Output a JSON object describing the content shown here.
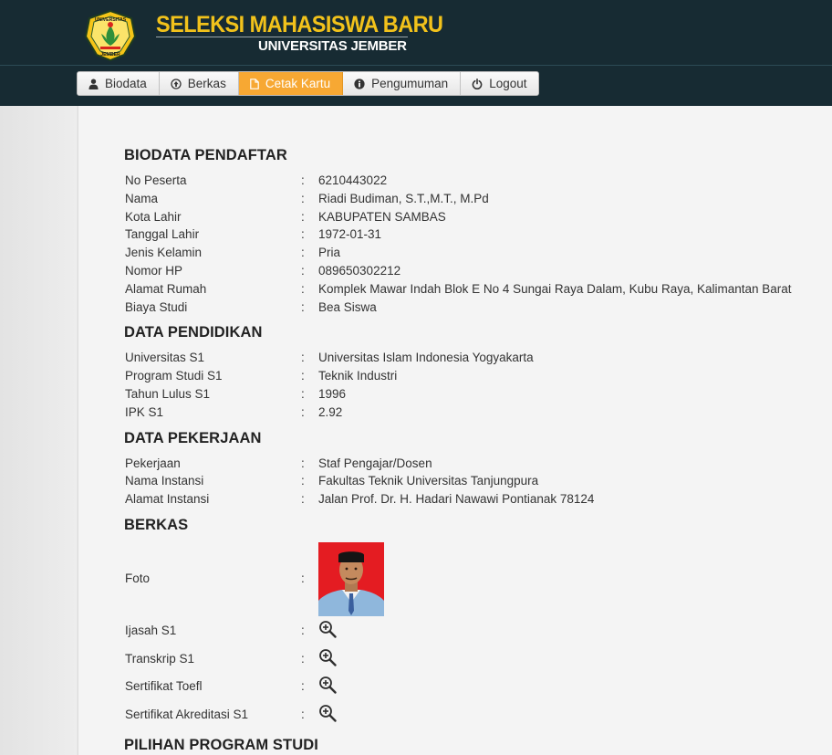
{
  "header": {
    "title": "SELEKSI MAHASISWA BARU",
    "subtitle": "UNIVERSITAS JEMBER",
    "logo_text_top": "UNIVERSITAS",
    "logo_text_bottom": "JEMBER"
  },
  "nav": {
    "items": [
      {
        "label": "Biodata",
        "icon": "user-icon"
      },
      {
        "label": "Berkas",
        "icon": "upload-icon"
      },
      {
        "label": "Cetak Kartu",
        "icon": "file-icon",
        "active": true
      },
      {
        "label": "Pengumuman",
        "icon": "info-icon"
      },
      {
        "label": "Logout",
        "icon": "power-icon"
      }
    ]
  },
  "biodata": {
    "title": "BIODATA PENDAFTAR",
    "rows": [
      {
        "label": "No Peserta",
        "value": "6210443022"
      },
      {
        "label": "Nama",
        "value": "Riadi Budiman, S.T.,M.T., M.Pd"
      },
      {
        "label": "Kota Lahir",
        "value": "KABUPATEN SAMBAS"
      },
      {
        "label": "Tanggal Lahir",
        "value": "1972-01-31"
      },
      {
        "label": "Jenis Kelamin",
        "value": "Pria"
      },
      {
        "label": "Nomor HP",
        "value": "089650302212"
      },
      {
        "label": "Alamat Rumah",
        "value": "Komplek Mawar Indah Blok E No 4 Sungai Raya Dalam, Kubu Raya, Kalimantan Barat"
      },
      {
        "label": "Biaya Studi",
        "value": "Bea Siswa"
      }
    ]
  },
  "pendidikan": {
    "title": "DATA PENDIDIKAN",
    "rows": [
      {
        "label": "Universitas S1",
        "value": "Universitas Islam Indonesia Yogyakarta"
      },
      {
        "label": "Program Studi S1",
        "value": "Teknik Industri"
      },
      {
        "label": "Tahun Lulus S1",
        "value": "1996"
      },
      {
        "label": "IPK S1",
        "value": "2.92"
      }
    ]
  },
  "pekerjaan": {
    "title": "DATA PEKERJAAN",
    "rows": [
      {
        "label": "Pekerjaan",
        "value": "Staf Pengajar/Dosen"
      },
      {
        "label": "Nama Instansi",
        "value": "Fakultas Teknik Universitas Tanjungpura"
      },
      {
        "label": "Alamat Instansi",
        "value": "Jalan Prof. Dr. H. Hadari Nawawi Pontianak 78124"
      }
    ]
  },
  "berkas": {
    "title": "BERKAS",
    "rows": [
      {
        "label": "Foto",
        "kind": "photo"
      },
      {
        "label": "Ijasah S1",
        "kind": "zoom-icon"
      },
      {
        "label": "Transkrip S1",
        "kind": "zoom-icon"
      },
      {
        "label": "Sertifikat Toefl",
        "kind": "zoom-icon"
      },
      {
        "label": "Sertifikat Akreditasi S1",
        "kind": "zoom-icon"
      }
    ]
  },
  "pilihan": {
    "title": "PILIHAN PROGRAM STUDI"
  },
  "separator": ":",
  "colors": {
    "header_bg": "#172b33",
    "title_yellow": "#f2c21b",
    "active_tab": "#f7a833",
    "photo_bg": "#e41c22"
  }
}
